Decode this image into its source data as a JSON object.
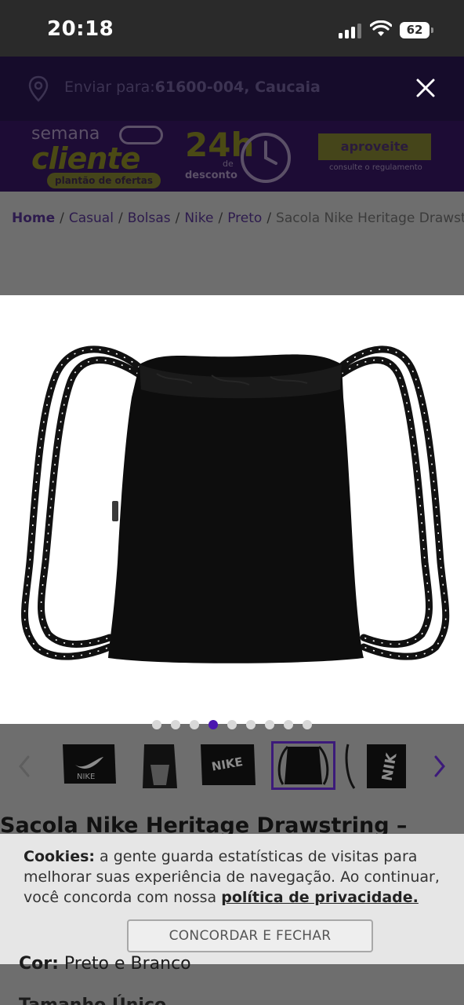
{
  "status_bar": {
    "time": "20:18",
    "battery": "62"
  },
  "shipping": {
    "label": "Enviar para:",
    "cep": "61600-004, Caucaia"
  },
  "promo": {
    "semana": "semana",
    "cliente": "cliente",
    "plantao": "plantão de ofertas",
    "hours": "24h",
    "de": "de",
    "desconto": "desconto",
    "cta": "aproveite",
    "regulamento": "consulte o regulamento"
  },
  "breadcrumb": {
    "items": [
      "Home",
      "Casual",
      "Bolsas",
      "Nike",
      "Preto"
    ],
    "separator": "/",
    "current": "Sacola Nike Heritage Drawstring"
  },
  "gallery": {
    "dot_count": 9,
    "active_index": 3
  },
  "thumbnails": {
    "count": 6,
    "active_index": 3
  },
  "product": {
    "title": "Sacola Nike Heritage Drawstring –",
    "color_label": "Cor:",
    "color_value": "Preto e Branco",
    "extra_label": "Tamanho Único"
  },
  "cookie": {
    "bold": "Cookies:",
    "text": " a gente guarda estatísticas de visitas para melhorar suas experiência de navegação. Ao continuar, você concorda com nossa ",
    "link": "política de privacidade.",
    "button": "CONCORDAR E FECHAR"
  },
  "colors": {
    "accent": "#4b16b0",
    "overlay": "#6e6e6e",
    "cookie_bg": "#e6e6e6",
    "header": "#160c2b"
  }
}
